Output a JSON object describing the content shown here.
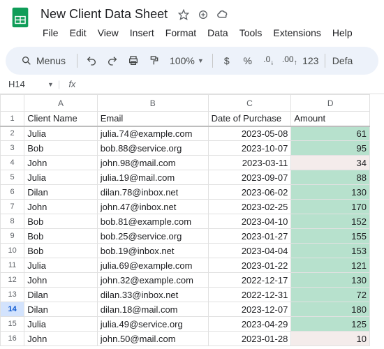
{
  "doc": {
    "title": "New Client Data Sheet"
  },
  "menus": {
    "file": "File",
    "edit": "Edit",
    "view": "View",
    "insert": "Insert",
    "format": "Format",
    "data": "Data",
    "tools": "Tools",
    "extensions": "Extensions",
    "help": "Help"
  },
  "toolbar": {
    "search_label": "Menus",
    "zoom": "100%",
    "currency": "$",
    "percent": "%",
    "decr": ".0",
    "incr": ".00",
    "num123": "123",
    "font": "Defa"
  },
  "namebox": {
    "cell": "H14"
  },
  "columns": {
    "A": "A",
    "B": "B",
    "C": "C",
    "D": "D"
  },
  "headers": {
    "a": "Client Name",
    "b": "Email",
    "c": "Date of Purchase",
    "d": "Amount"
  },
  "selected_row": 14,
  "rows": [
    {
      "n": 2,
      "name": "Julia",
      "email": "julia.74@example.com",
      "date": "2023-05-08",
      "amount": "61",
      "amt_cls": "amt-green"
    },
    {
      "n": 3,
      "name": "Bob",
      "email": "bob.88@service.org",
      "date": "2023-10-07",
      "amount": "95",
      "amt_cls": "amt-green"
    },
    {
      "n": 4,
      "name": "John",
      "email": "john.98@mail.com",
      "date": "2023-03-11",
      "amount": "34",
      "amt_cls": "amt-pink"
    },
    {
      "n": 5,
      "name": "Julia",
      "email": "julia.19@mail.com",
      "date": "2023-09-07",
      "amount": "88",
      "amt_cls": "amt-green"
    },
    {
      "n": 6,
      "name": "Dilan",
      "email": "dilan.78@inbox.net",
      "date": "2023-06-02",
      "amount": "130",
      "amt_cls": "amt-green"
    },
    {
      "n": 7,
      "name": "John",
      "email": "john.47@inbox.net",
      "date": "2023-02-25",
      "amount": "170",
      "amt_cls": "amt-green"
    },
    {
      "n": 8,
      "name": "Bob",
      "email": "bob.81@example.com",
      "date": "2023-04-10",
      "amount": "152",
      "amt_cls": "amt-green"
    },
    {
      "n": 9,
      "name": "Bob",
      "email": "bob.25@service.org",
      "date": "2023-01-27",
      "amount": "155",
      "amt_cls": "amt-green"
    },
    {
      "n": 10,
      "name": "Bob",
      "email": "bob.19@inbox.net",
      "date": "2023-04-04",
      "amount": "153",
      "amt_cls": "amt-green"
    },
    {
      "n": 11,
      "name": "Julia",
      "email": "julia.69@example.com",
      "date": "2023-01-22",
      "amount": "121",
      "amt_cls": "amt-green"
    },
    {
      "n": 12,
      "name": "John",
      "email": "john.32@example.com",
      "date": "2022-12-17",
      "amount": "130",
      "amt_cls": "amt-green"
    },
    {
      "n": 13,
      "name": "Dilan",
      "email": "dilan.33@inbox.net",
      "date": "2022-12-31",
      "amount": "72",
      "amt_cls": "amt-green"
    },
    {
      "n": 14,
      "name": "Dilan",
      "email": "dilan.18@mail.com",
      "date": "2023-12-07",
      "amount": "180",
      "amt_cls": "amt-green"
    },
    {
      "n": 15,
      "name": "Julia",
      "email": "julia.49@service.org",
      "date": "2023-04-29",
      "amount": "125",
      "amt_cls": "amt-green"
    },
    {
      "n": 16,
      "name": "John",
      "email": "john.50@mail.com",
      "date": "2023-01-28",
      "amount": "10",
      "amt_cls": "amt-pink"
    }
  ]
}
